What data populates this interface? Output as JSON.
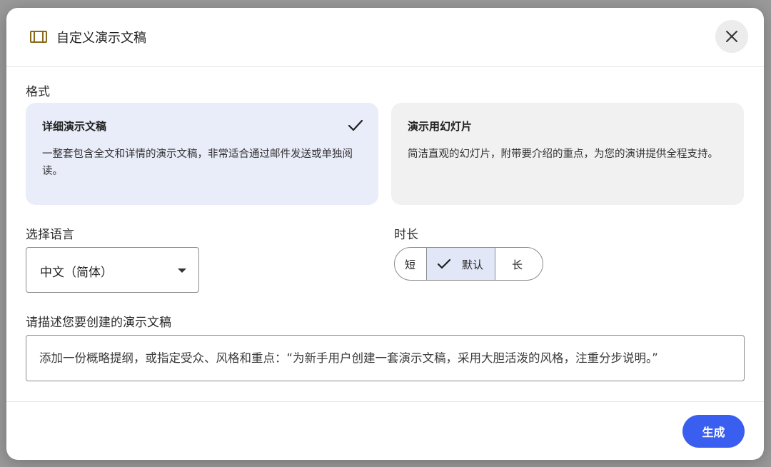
{
  "dialog": {
    "title": "自定义演示文稿",
    "icon": "presentation-icon"
  },
  "format": {
    "label": "格式",
    "options": [
      {
        "title": "详细演示文稿",
        "description": "一整套包含全文和详情的演示文稿，非常适合通过邮件发送或单独阅读。",
        "selected": true
      },
      {
        "title": "演示用幻灯片",
        "description": "简洁直观的幻灯片，附带要介绍的重点，为您的演讲提供全程支持。",
        "selected": false
      }
    ]
  },
  "language": {
    "label": "选择语言",
    "selected": "中文（简体）"
  },
  "duration": {
    "label": "时长",
    "options": [
      "短",
      "默认",
      "长"
    ],
    "selected": "默认"
  },
  "prompt": {
    "label": "请描述您要创建的演示文稿",
    "placeholder": "添加一份概略提纲，或指定受众、风格和重点：“为新手用户创建一套演示文稿，采用大胆活泼的风格，注重分步说明。”"
  },
  "footer": {
    "generate_label": "生成"
  },
  "colors": {
    "accent": "#3a5ef0",
    "selected_card": "#e9ecf9",
    "icon": "#8a6a1a"
  }
}
